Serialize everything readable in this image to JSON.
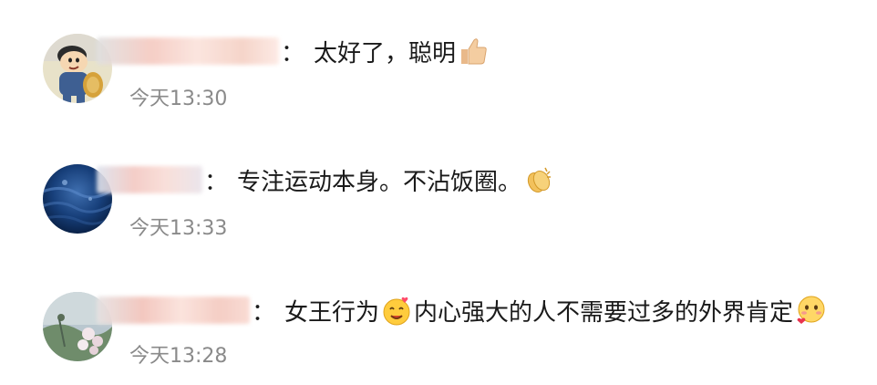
{
  "comments": [
    {
      "avatar": "cartoon-boy-avatar",
      "text_a": "太好了，聪明",
      "emoji_a": "thumbs-up-emoji",
      "time": "今天13:30"
    },
    {
      "avatar": "blue-water-avatar",
      "text_a": "专注运动本身。不沾饭圈。",
      "emoji_a": "clapping-hands-emoji",
      "time": "今天13:33"
    },
    {
      "avatar": "flowers-avatar",
      "text_a": "女王行为",
      "emoji_a": "smiling-hearts-emoji",
      "text_b": "内心强大的人不需要过多的外界肯定",
      "emoji_b": "blushing-heart-emoji",
      "time": "今天13:28"
    }
  ],
  "separator": "："
}
